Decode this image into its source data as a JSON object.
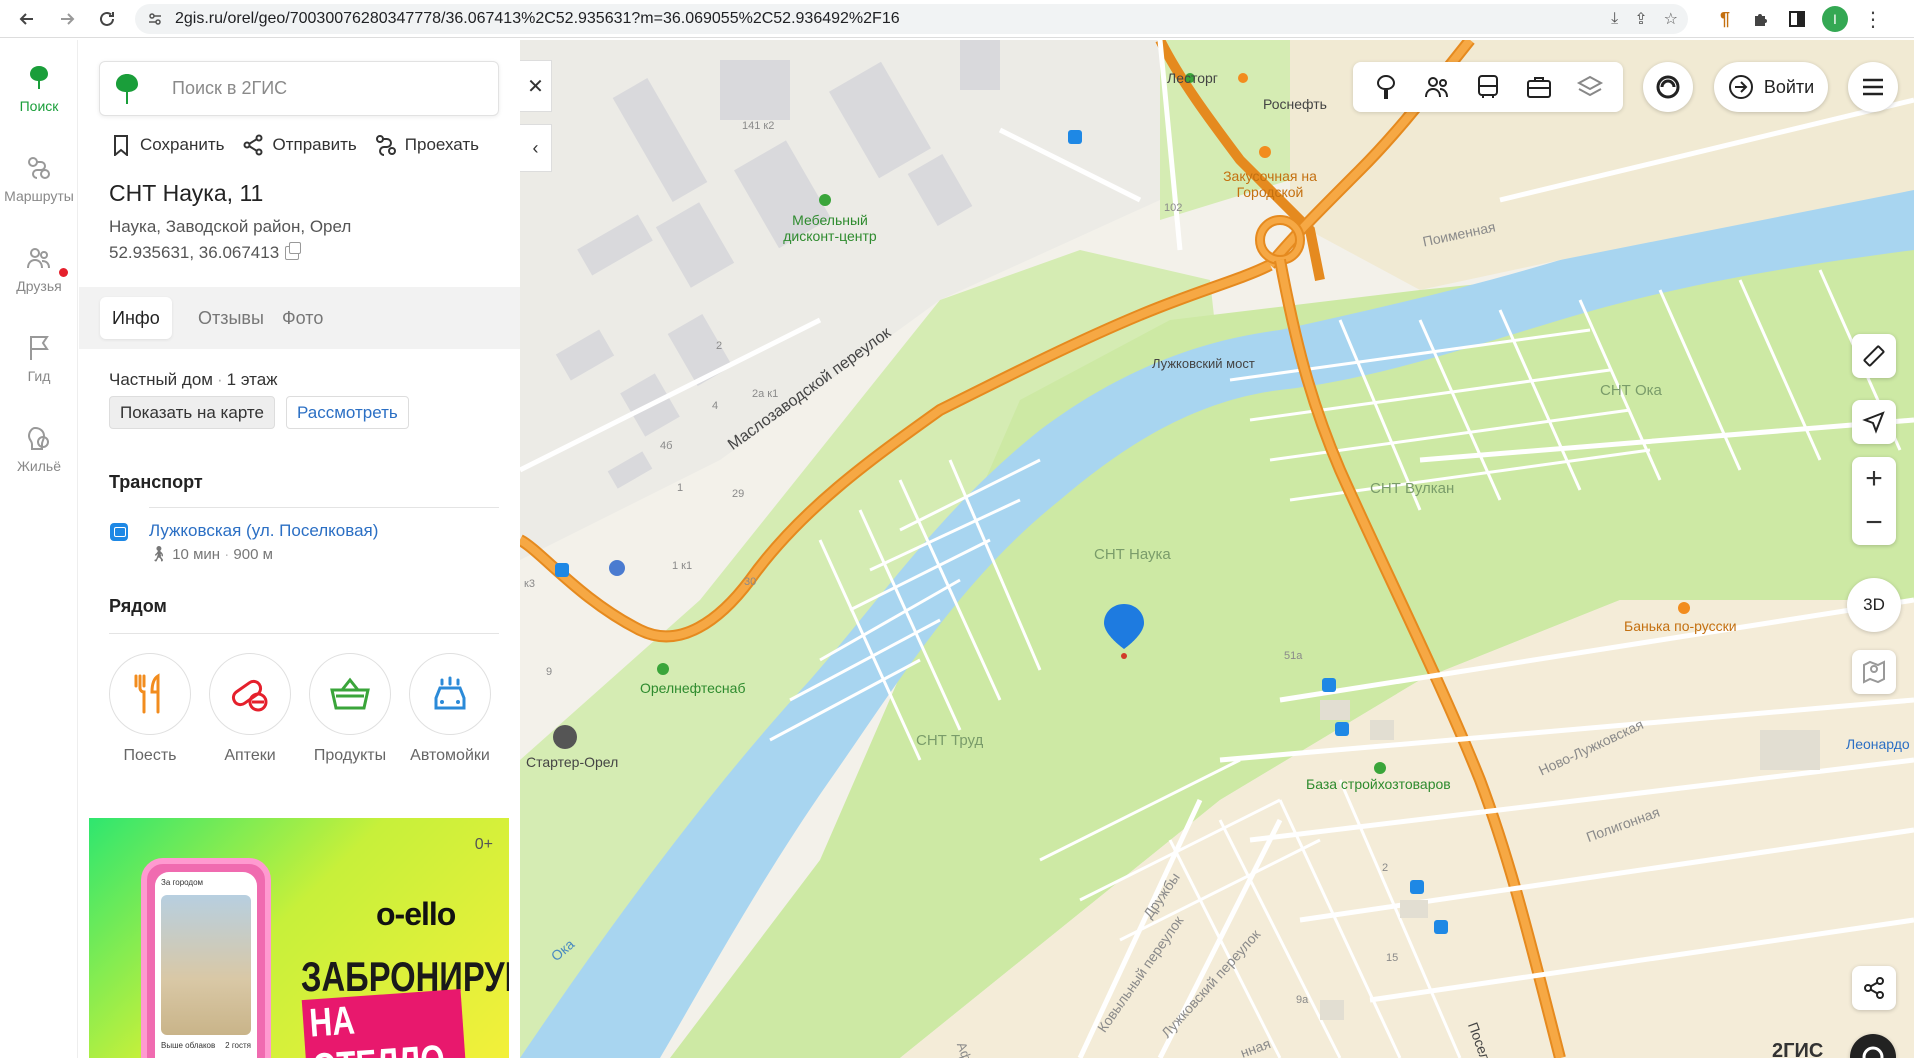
{
  "browser": {
    "url": "2gis.ru/orel/geo/70030076280347778/36.067413%2C52.935631?m=36.069055%2C52.936492%2F16",
    "profile_initial": "I"
  },
  "rail": {
    "items": [
      {
        "label": "Поиск",
        "icon": "tree-logo-icon"
      },
      {
        "label": "Маршруты",
        "icon": "routes-icon"
      },
      {
        "label": "Друзья",
        "icon": "friends-icon"
      },
      {
        "label": "Гид",
        "icon": "flag-icon"
      },
      {
        "label": "Жильё",
        "icon": "housing-icon"
      }
    ]
  },
  "panel": {
    "search_placeholder": "Поиск в 2ГИС",
    "actions": {
      "save": "Сохранить",
      "send": "Отправить",
      "route": "Проехать"
    },
    "title": "СНТ Наука, 11",
    "address": "Наука, Заводской район, Орел",
    "coords": "52.935631, 36.067413",
    "tabs": [
      "Инфо",
      "Отзывы",
      "Фото"
    ],
    "building": {
      "type": "Частный дом",
      "floors": "1 этаж"
    },
    "show_on_map": "Показать на карте",
    "inspect": "Рассмотреть",
    "transport": {
      "heading": "Транспорт",
      "stop": "Лужковская (ул. Поселковая)",
      "walk": "10 мин",
      "distance": "900 м"
    },
    "nearby": {
      "heading": "Рядом",
      "items": [
        {
          "label": "Поесть",
          "color": "#f28c1e"
        },
        {
          "label": "Аптеки",
          "color": "#e5202c"
        },
        {
          "label": "Продукты",
          "color": "#3aa53a"
        },
        {
          "label": "Автомойки",
          "color": "#2b8ad8"
        }
      ]
    },
    "ad": {
      "age": "0+",
      "brand": "o-ello",
      "line1": "ЗАБРОНИРУЙ",
      "line2": "НА ОТЕЛЛО",
      "phone_search": "За городом",
      "phone_caption_left": "Выше облаков",
      "phone_caption_right": "2 гостя"
    }
  },
  "map": {
    "labels": {
      "lestorg": "Лесторг",
      "rosneft": "Роснефть",
      "zakusochnaya": "Закусочная на Городской",
      "b141": "141 к2",
      "mebel": "Мебельный дисконт-центр",
      "n102": "102",
      "poimennaya": "Поименная",
      "most": "Лужковский мост",
      "sntoka": "СНТ Ока",
      "maslo": "Маслозаводской переулок",
      "n2": "2",
      "n2a": "2а к1",
      "n4": "4",
      "n4b": "4б",
      "n1": "1",
      "n29": "29",
      "n1k1": "1 к1",
      "n30": "30",
      "k3": "к3",
      "n9": "9",
      "vulkan": "СНТ Вулкан",
      "nauka": "СНТ Наука",
      "banka": "Банька по-русски",
      "orelneft": "Орелнефтеснаб",
      "n51a": "51а",
      "starter": "Стартер-Орел",
      "trud": "СНТ Труд",
      "leonardo": "Леонардо",
      "novoluzh": "Ново-Лужковская",
      "baza": "База стройхозтоваров",
      "poligon": "Полигонная",
      "druzhby": "Дружбы",
      "kovylny": "Ковыльный переулок",
      "luzhkov": "Лужковский переулок",
      "n2b": "2",
      "n15": "15",
      "n9a": "9а",
      "oka": "Ока",
      "afon": "Афон",
      "posel": "Посел",
      "nnaya": "нная"
    },
    "login": "Войти",
    "btn_3d": "3D",
    "logo": "2ГИС"
  }
}
